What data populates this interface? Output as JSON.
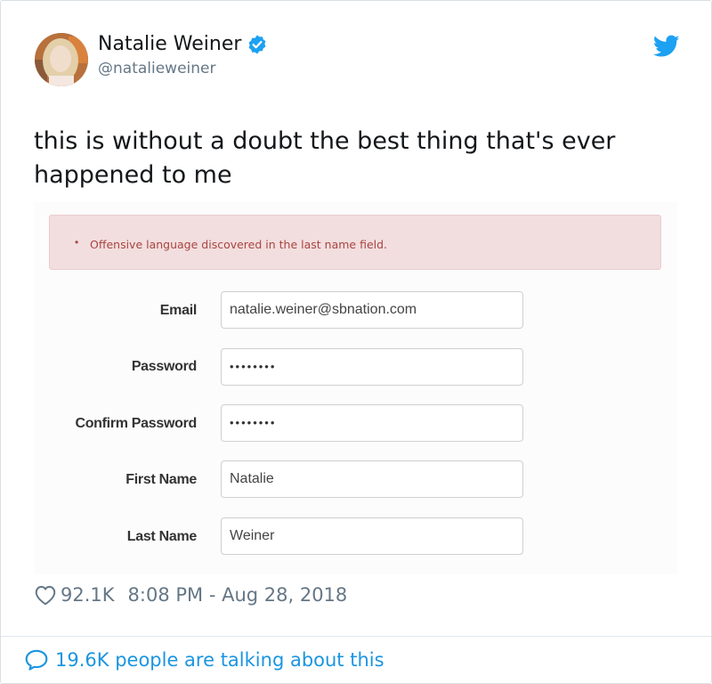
{
  "tweet": {
    "display_name": "Natalie Weiner",
    "handle": "@natalieweiner",
    "text": "this is without a doubt the best thing that's ever happened to me",
    "likes": "92.1K",
    "timestamp": "8:08 PM - Aug 28, 2018",
    "talking": "19.6K people are talking about this"
  },
  "icons": {
    "verified": "verified-badge-icon",
    "brand": "twitter-bird-icon",
    "like": "heart-icon",
    "reply": "speech-bubble-icon"
  },
  "form": {
    "alert": "Offensive language discovered in the last name field.",
    "alert_bullet": "•",
    "fields": [
      {
        "label": "Email",
        "value": "natalie.weiner@sbnation.com"
      },
      {
        "label": "Password",
        "value": "••••••••"
      },
      {
        "label": "Confirm Password",
        "value": "••••••••"
      },
      {
        "label": "First Name",
        "value": "Natalie"
      },
      {
        "label": "Last Name",
        "value": "Weiner"
      }
    ]
  },
  "colors": {
    "twitter_blue": "#1da1f2",
    "link_blue": "#1b95e0",
    "alert_bg": "#f2dede",
    "alert_text": "#a94442",
    "muted": "#657786"
  }
}
